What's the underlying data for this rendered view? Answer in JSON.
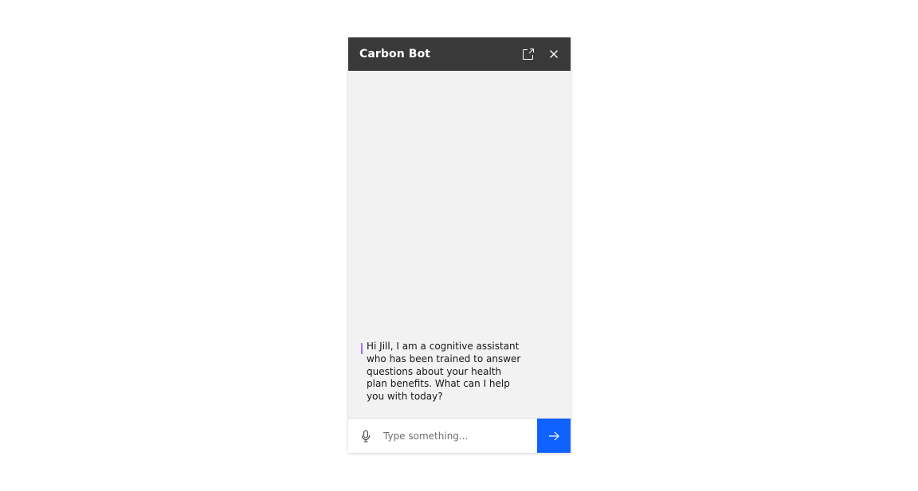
{
  "header": {
    "title": "Carbon Bot",
    "buttons": [
      {
        "icon": "launch-icon"
      },
      {
        "icon": "close-icon"
      }
    ]
  },
  "messages": [
    {
      "sender": "bot",
      "text": "Hi Jill, I am a cognitive assistant who has been trained to answer questions about your health plan benefits. What can I help you with today?"
    }
  ],
  "input": {
    "placeholder": "Type something...",
    "value": "",
    "mic_icon": "microphone-icon",
    "send_icon": "arrow-right-icon"
  },
  "colors": {
    "header_bg": "#393939",
    "body_bg": "#f2f2f2",
    "accent": "#a56eff",
    "send_bg": "#0f62fe"
  }
}
